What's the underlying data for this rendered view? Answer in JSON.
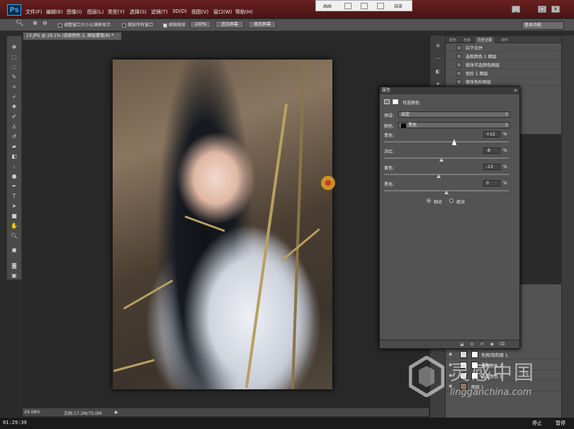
{
  "menubar": {
    "items": [
      "文件(F)",
      "编辑(E)",
      "图像(I)",
      "图层(L)",
      "类型(Y)",
      "选择(S)",
      "滤镜(T)",
      "3D(D)",
      "视图(V)",
      "窗口(W)",
      "帮助(H)"
    ]
  },
  "recorder": {
    "left_label": "画画",
    "right_label": "结束"
  },
  "options": {
    "resize_windows": "调整窗口大小以满屏显示",
    "zoom_all": "缩放所有窗口",
    "scrubby_zoom": "细微缩放",
    "btn_100": "100%",
    "btn_fit": "适合屏幕",
    "btn_fill": "填充屏幕",
    "workspace": "基本功能"
  },
  "document": {
    "tab": "13.JPG @ 29.1% (选取颜色 2, 图层蒙版/8) *",
    "close": "×"
  },
  "status": {
    "zoom": "29.08%",
    "doc_size": "文档:17.2M/75.0M"
  },
  "timer": {
    "elapsed": "01:29:39",
    "stop": "停止",
    "pause": "暂停"
  },
  "history_panel": {
    "tabs": [
      "颜色",
      "色板",
      "历史记录",
      "动作"
    ],
    "items": [
      "向下合并",
      "选取颜色 1 图层",
      "修改可选颜色图层",
      "色阶 1 图层",
      "修改色阶图层"
    ]
  },
  "layers_panel": {
    "items": [
      "色相/饱和度 1",
      "选取颜色 2",
      "选取颜色 1",
      "图层 1"
    ]
  },
  "properties": {
    "title": "属性",
    "header": "可选颜色",
    "preset_label": "预设:",
    "preset_value": "自定",
    "colors_label": "颜色:",
    "colors_value": "黑色",
    "sliders": [
      {
        "label": "青色:",
        "value": "+12",
        "pct": 0.56
      },
      {
        "label": "洋红:",
        "value": "-8",
        "pct": 0.46
      },
      {
        "label": "黄色:",
        "value": "-13",
        "pct": 0.44
      },
      {
        "label": "黑色:",
        "value": "0",
        "pct": 0.5
      }
    ],
    "percent_sign": "%",
    "method_relative": "相对",
    "method_absolute": "绝对"
  },
  "watermark": {
    "cn": "灵感中国",
    "en": "lingganchina.com"
  }
}
